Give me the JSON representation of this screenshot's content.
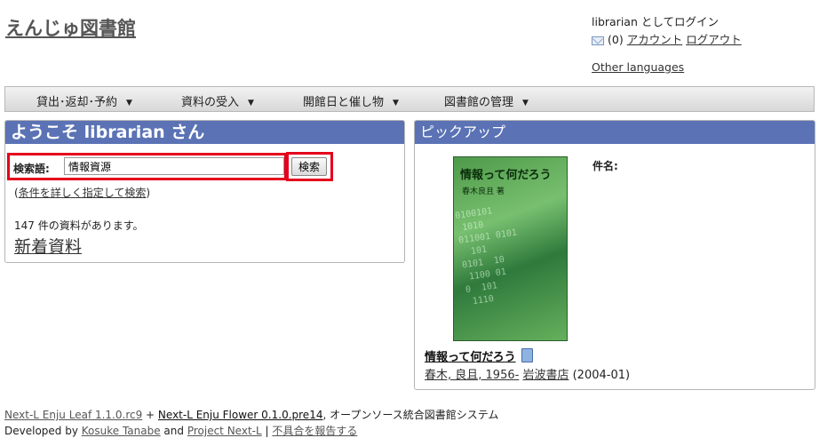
{
  "site": {
    "title": "えんじゅ図書館"
  },
  "user": {
    "login_text": "librarian としてログイン",
    "message_count": "(0)",
    "account_link": "アカウント",
    "logout_link": "ログアウト",
    "other_languages": "Other languages"
  },
  "menu": {
    "items": [
      {
        "label": "貸出･返却･予約"
      },
      {
        "label": "資料の受入"
      },
      {
        "label": "開館日と催し物"
      },
      {
        "label": "図書館の管理"
      }
    ],
    "caret": "▼"
  },
  "welcome": {
    "heading": "ようこそ librarian さん",
    "search_label": "検索語:",
    "search_value": "情報資源",
    "search_button": "検索",
    "advanced_search": "条件を詳しく指定して検索",
    "count_text": "147 件の資料があります。",
    "new_arrivals": "新着資料"
  },
  "pickup": {
    "heading": "ピックアップ",
    "subject_label": "件名:",
    "cover": {
      "title": "情報って何だろう",
      "author": "春木良且 著",
      "digits": "0100101\n 1010\n011001 0101\n  101\n0101  10\n 1100 01\n0  101\n 1110"
    },
    "book": {
      "title": "情報って何だろう",
      "author": "春木, 良且, 1956-",
      "publisher": "岩波書店",
      "date": "(2004-01)"
    }
  },
  "footer": {
    "leaf": "Next-L Enju Leaf 1.1.0.rc9",
    "plus": " + ",
    "flower": "Next-L Enju Flower 0.1.0.pre14",
    "system_text": ", オープンソース統合図書館システム",
    "developed_by": "Developed by ",
    "developer": "Kosuke Tanabe",
    "and": " and ",
    "project": "Project Next-L",
    "separator": " | ",
    "report": "不具合を報告する"
  },
  "colors": {
    "panel_header": "#5b73b5",
    "highlight": "#e4001c"
  }
}
